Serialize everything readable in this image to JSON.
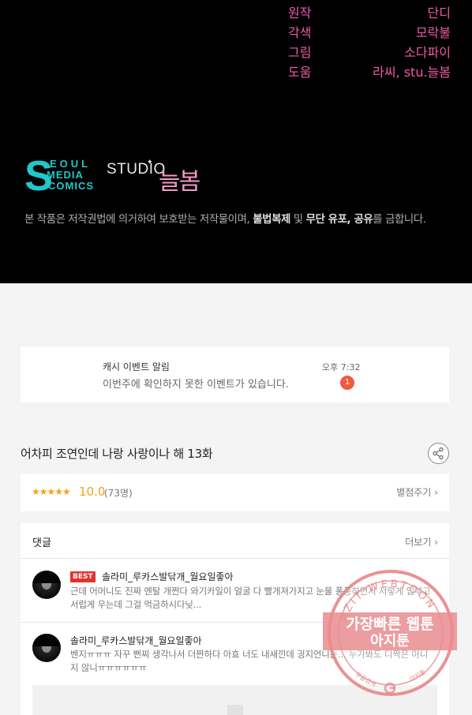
{
  "credits": [
    {
      "role": "원작",
      "name": "단디"
    },
    {
      "role": "각색",
      "name": "모락불"
    },
    {
      "role": "그림",
      "name": "소다파이"
    },
    {
      "role": "도움",
      "name": "라씨, stu.늘봄"
    }
  ],
  "logos": {
    "seoul_letter": "S",
    "seoul_lines": [
      "EOUL",
      "MEDIA",
      "COMICS"
    ],
    "studio_word": "STUDIO",
    "studio_name": "늘봄"
  },
  "copyright": {
    "prefix": "본 작품은 저작권법에 의거하여 보호받는 저작물이며, ",
    "bold1": "불법복제",
    "mid1": " 및 ",
    "bold2": "무단 유포, 공유",
    "suffix": "를 금합니다."
  },
  "notice": {
    "title": "캐시 이벤트 알림",
    "message": "이번주에 확인하지 못한 이벤트가 있습니다.",
    "time": "오후 7:32",
    "badge": "1"
  },
  "episode": {
    "title": "어차피 조연인데 나랑 사랑이나 해 13화",
    "share_icon": "share-icon"
  },
  "rating": {
    "stars": "★★★★★",
    "score": "10.0",
    "count": "(73명)",
    "rate_label": "별점주기"
  },
  "comments": {
    "header": "댓글",
    "more_label": "더보기",
    "items": [
      {
        "best": "BEST",
        "nickname": "솔라미_루카스발닦개_월요일좋아",
        "text": "근데 어머니도 진짜 멘탈 개쩐다 와기카일이 얼굴 다 빨개져가지고 눈물 퐁퐁하면서 저렇게 입부고 서럽게 우는데 그걸 먹금하시다닞..."
      },
      {
        "nickname": "솔라미_루카스발닦개_월요일좋아",
        "text": "벤지ㅠㅠㅠ 자꾸 삔찌 생각나서 더짠하다 아효 너도 내새낀데 긩지언니는... 누가봐도 디짝은 아니지 않니ㅠㅠㅠㅠㅠㅠ"
      }
    ]
  },
  "watermark": {
    "arc_text": "AZIT WEBTOON",
    "line1": "가장빠른 웹툰",
    "line2": "아지툰",
    "bottom_left": "구글검색",
    "bottom_right": "아지툰",
    "color": "#e8878a"
  }
}
